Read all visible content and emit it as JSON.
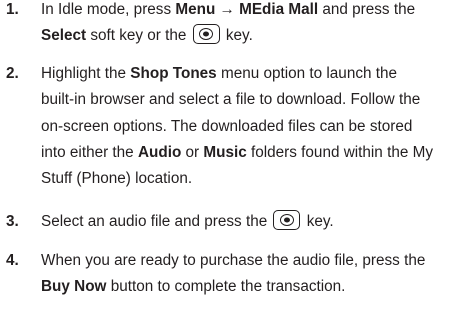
{
  "steps": [
    {
      "number": "1.",
      "line1": {
        "pre": "In Idle mode, press ",
        "menu": "Menu",
        "arrow": "→",
        "mall": "MEdia Mall",
        "post": " and press the"
      },
      "line2": {
        "select": "Select",
        "mid": " soft key or the ",
        "key_icon": "select-key-icon",
        "post": " key."
      }
    },
    {
      "number": "2.",
      "line1": {
        "pre": "Highlight the ",
        "shop": "Shop Tones",
        "post": " menu option to launch the"
      },
      "line2": "built-in browser and select a file to download. Follow the",
      "line3": "on-screen options. The downloaded files can be stored",
      "line4": {
        "pre": "into either the ",
        "audio": "Audio",
        "or": " or ",
        "music": "Music",
        "post": " folders found within the My"
      },
      "line5": "Stuff (Phone) location."
    },
    {
      "number": "3.",
      "line1": {
        "pre": "Select an audio file and press the ",
        "key_icon": "select-key-icon",
        "post": " key."
      }
    },
    {
      "number": "4.",
      "line1": "When you are ready to purchase the audio file, press the",
      "line2": {
        "buy": "Buy Now",
        "post": " button to complete the transaction."
      }
    }
  ]
}
